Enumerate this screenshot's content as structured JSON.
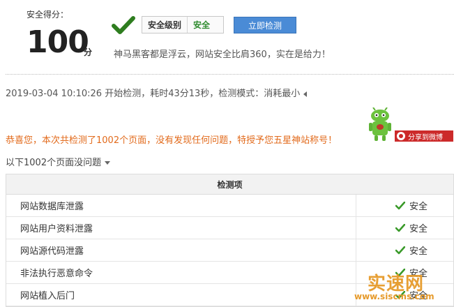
{
  "score": {
    "label": "安全得分：",
    "value": "100",
    "unit": "分"
  },
  "level": {
    "label": "安全级别",
    "value": "安全",
    "value_color": "#2e8b2e"
  },
  "actions": {
    "detect_button": "立即检测"
  },
  "slogan": "神马黑客都是浮云，网站安全比肩360，实在是给力！",
  "detect_info": "2019-03-04 10:10:26 开始检测，耗时43分13秒，检测模式：消耗最小",
  "congrats": "恭喜您，本次共检测了1002个页面，没有发现任何问题，特授予您五星神站称号！",
  "share_label": "分享到微博",
  "list_title": "以下1002个页面没问题",
  "table": {
    "header": "检测项",
    "rows": [
      {
        "item": "网站数据库泄露",
        "status": "安全"
      },
      {
        "item": "网站用户资料泄露",
        "status": "安全"
      },
      {
        "item": "网站源代码泄露",
        "status": "安全"
      },
      {
        "item": "非法执行恶意命令",
        "status": "安全"
      },
      {
        "item": "网站植入后门",
        "status": "安全"
      }
    ]
  },
  "watermark": {
    "title": "实速网",
    "url": "www.siscms.com"
  },
  "colors": {
    "accent_button": "#4a8bd6",
    "congrats_text": "#e26a1b",
    "check_green": "#3a9a2a",
    "share_red": "#cc2a2a"
  },
  "icons": [
    "check-icon",
    "triangle-left-icon",
    "triangle-down-icon",
    "mascot-icon",
    "weibo-icon"
  ]
}
